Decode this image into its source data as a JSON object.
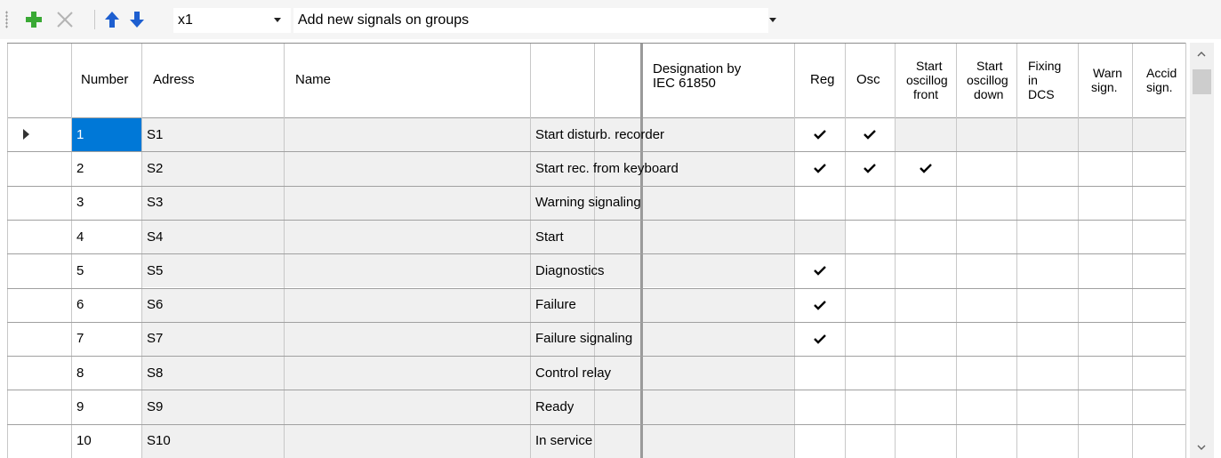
{
  "toolbar": {
    "add_icon": "plus-icon",
    "delete_icon": "x-icon",
    "up_icon": "arrow-up-icon",
    "down_icon": "arrow-down-icon",
    "multiplier": "x1",
    "group_mode": "Add new signals on groups"
  },
  "columns": {
    "number": "Number",
    "address": "Adress",
    "name": "Name",
    "designation_l1": "Designation by",
    "designation_l2": "IEC 61850",
    "reg": "Reg",
    "osc": "Osc",
    "start_front_l1": "Start",
    "start_front_l2": "oscillog",
    "start_front_l3": "front",
    "start_down_l1": "Start",
    "start_down_l2": "oscillog",
    "start_down_l3": "down",
    "fixing_l1": "Fixing",
    "fixing_l2": "in",
    "fixing_l3": "DCS",
    "warn_l1": "Warn",
    "warn_l2": "sign.",
    "accid_l1": "Accid",
    "accid_l2": "sign."
  },
  "rows": [
    {
      "number": "1",
      "address": "S1",
      "name": "Start disturb. recorder",
      "reg": true,
      "osc": true,
      "front": false
    },
    {
      "number": "2",
      "address": "S2",
      "name": "Start rec. from keyboard",
      "reg": true,
      "osc": true,
      "front": true
    },
    {
      "number": "3",
      "address": "S3",
      "name": "Warning signaling",
      "reg": false,
      "osc": false,
      "front": false
    },
    {
      "number": "4",
      "address": "S4",
      "name": "Start",
      "reg": false,
      "osc": false,
      "front": false
    },
    {
      "number": "5",
      "address": "S5",
      "name": "Diagnostics",
      "reg": true,
      "osc": false,
      "front": false
    },
    {
      "number": "6",
      "address": "S6",
      "name": "Failure",
      "reg": true,
      "osc": false,
      "front": false
    },
    {
      "number": "7",
      "address": "S7",
      "name": "Failure signaling",
      "reg": true,
      "osc": false,
      "front": false
    },
    {
      "number": "8",
      "address": "S8",
      "name": "Control relay",
      "reg": false,
      "osc": false,
      "front": false
    },
    {
      "number": "9",
      "address": "S9",
      "name": "Ready",
      "reg": false,
      "osc": false,
      "front": false
    },
    {
      "number": "10",
      "address": "S10",
      "name": "In service",
      "reg": false,
      "osc": false,
      "front": false
    }
  ],
  "selected_row": 1,
  "colors": {
    "add": "#3aa935",
    "delete": "#b4b4b4",
    "arrows": "#1e5fd0",
    "selection": "#0078d7",
    "readonly_cell": "#f0f0f0"
  }
}
